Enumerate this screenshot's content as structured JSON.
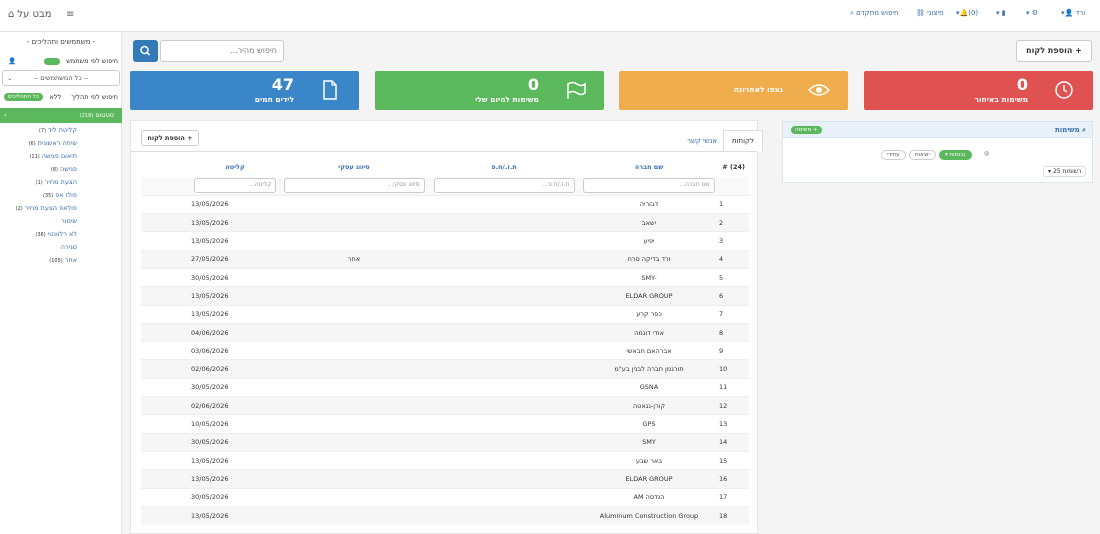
{
  "topbar": {
    "logo": "מבט על",
    "user": "ורד",
    "notifications": "(0)",
    "external": "חיצוני",
    "advanced_search": "חיפוש מתקדם"
  },
  "sidebar": {
    "title": "- משתמשים ותהליכים -",
    "search_by_user": "חיפוש לפי משתמש",
    "all_users_select": "-- כל המשתמשים --",
    "search_by_process": "חיפוש לפי תהליך",
    "no": "ללא",
    "all_processes": "כל התהליכים",
    "status_label": "סטטוס",
    "status_count": "(218)",
    "items": [
      {
        "label": "קליטת ליד",
        "count": "(7)"
      },
      {
        "label": "שיחה ראשונית",
        "count": "(6)"
      },
      {
        "label": "תיאום פגישה",
        "count": "(11)"
      },
      {
        "label": "פגישה",
        "count": "(8)"
      },
      {
        "label": "הצעת מחיר",
        "count": "(1)"
      },
      {
        "label": "פולו אפ",
        "count": "(35)"
      },
      {
        "label": "פולאפ הצעת מחיר",
        "count": "(2)"
      },
      {
        "label": "שימור",
        "count": ""
      },
      {
        "label": "לא רלוונטי",
        "count": "(36)"
      },
      {
        "label": "סגירה",
        "count": ""
      },
      {
        "label": "אחר",
        "count": "(105)"
      }
    ]
  },
  "search": {
    "placeholder": "חיפוש מהיר..."
  },
  "add_customer": "הוספת לקוח",
  "cards": [
    {
      "num": "0",
      "label": "משימות באיחור",
      "color": "#e05252"
    },
    {
      "num": "",
      "label": "נצפו לאחרונה",
      "color": "#f0ad4e"
    },
    {
      "num": "0",
      "label": "משימות להיום שלי",
      "color": "#5cb85c"
    },
    {
      "num": "47",
      "label": "לידים חמים",
      "color": "#3a86c8"
    }
  ],
  "tabs": {
    "customers": "לקוחות",
    "contacts": "אנשי קשר"
  },
  "table": {
    "add_customer": "הוספת לקוח",
    "headers": {
      "num": "# (24)",
      "company": "שם חברה",
      "id": "ת.ז./ח.פ",
      "category": "סיווג עסקי",
      "intake": "קליטה"
    },
    "filters": {
      "company": "שם חברה...",
      "id": "ת.ז./ח.פ...",
      "category": "סיווג עסקי...",
      "intake": "קליטה..."
    },
    "rows": [
      {
        "n": "1",
        "company": "דבוריה",
        "id": "",
        "cat": "",
        "date": "13/05/2026"
      },
      {
        "n": "2",
        "company": "ישאב",
        "id": "",
        "cat": "",
        "date": "13/05/2026"
      },
      {
        "n": "3",
        "company": "יפיע",
        "id": "",
        "cat": "",
        "date": "13/05/2026"
      },
      {
        "n": "4",
        "company": "ורד בדיקה סרח",
        "id": "",
        "cat": "אחר",
        "date": "27/05/2026"
      },
      {
        "n": "5",
        "company": "SMY-",
        "id": "",
        "cat": "",
        "date": "30/05/2026"
      },
      {
        "n": "6",
        "company": "ELDAR GROUP",
        "id": "",
        "cat": "",
        "date": "13/05/2026"
      },
      {
        "n": "7",
        "company": "כפר קרע",
        "id": "",
        "cat": "",
        "date": "13/05/2026"
      },
      {
        "n": "8",
        "company": "אודי דוגמה",
        "id": "",
        "cat": "",
        "date": "04/06/2026"
      },
      {
        "n": "9",
        "company": "אברהאם חבאשי",
        "id": "",
        "cat": "",
        "date": "03/06/2026"
      },
      {
        "n": "10",
        "company": "תורגמן חברה לבנין בע\"מ",
        "id": "",
        "cat": "",
        "date": "02/06/2026"
      },
      {
        "n": "11",
        "company": "GSNA",
        "id": "",
        "cat": "",
        "date": "30/05/2026"
      },
      {
        "n": "12",
        "company": "קורן-נגאטה",
        "id": "",
        "cat": "",
        "date": "02/06/2026"
      },
      {
        "n": "13",
        "company": "GPS",
        "id": "",
        "cat": "",
        "date": "10/05/2026"
      },
      {
        "n": "14",
        "company": "SMY",
        "id": "",
        "cat": "",
        "date": "30/05/2026"
      },
      {
        "n": "15",
        "company": "באר שבע",
        "id": "",
        "cat": "",
        "date": "13/05/2026"
      },
      {
        "n": "16",
        "company": "ELDAR GROUP",
        "id": "",
        "cat": "",
        "date": "13/05/2026"
      },
      {
        "n": "17",
        "company": "AM הנדסה",
        "id": "",
        "cat": "",
        "date": "30/05/2026"
      },
      {
        "n": "18",
        "company": "Aluminum Construction Group",
        "id": "",
        "cat": "",
        "date": "13/05/2026"
      }
    ]
  },
  "tasks": {
    "title": "משימות",
    "add": "משימה",
    "tag_incoming": "נכנסות",
    "tag_outgoing": "יוצאות",
    "tag_future": "עתידי",
    "per_page": "25 רשומות"
  }
}
